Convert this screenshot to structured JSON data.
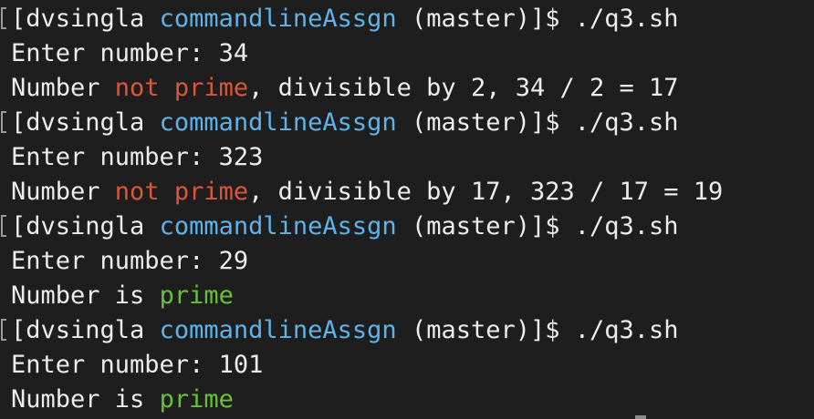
{
  "terminal": {
    "lines": [
      {
        "kind": "prompt",
        "open": "[",
        "user": "dvsingla",
        "dir": "commandlineAssgn",
        "branch": "(master)]$",
        "command": "./q3.sh"
      },
      {
        "kind": "output",
        "text": "Enter number: 34"
      },
      {
        "kind": "result",
        "prefix": "Number ",
        "status": "not prime",
        "suffix": ", divisible by 2, 34 / 2 = 17"
      },
      {
        "kind": "prompt",
        "open": "[",
        "user": "dvsingla",
        "dir": "commandlineAssgn",
        "branch": "(master)]$",
        "command": "./q3.sh"
      },
      {
        "kind": "output",
        "text": "Enter number: 323"
      },
      {
        "kind": "result",
        "prefix": "Number ",
        "status": "not prime",
        "suffix": ", divisible by 17, 323 / 17 = 19"
      },
      {
        "kind": "prompt",
        "open": "[",
        "user": "dvsingla",
        "dir": "commandlineAssgn",
        "branch": "(master)]$",
        "command": "./q3.sh"
      },
      {
        "kind": "output",
        "text": "Enter number: 29"
      },
      {
        "kind": "result",
        "prefix": "Number is ",
        "status": "prime",
        "suffix": ""
      },
      {
        "kind": "prompt",
        "open": "[",
        "user": "dvsingla",
        "dir": "commandlineAssgn",
        "branch": "(master)]$",
        "command": "./q3.sh"
      },
      {
        "kind": "output",
        "text": "Enter number: 101"
      },
      {
        "kind": "result",
        "prefix": "Number is ",
        "status": "prime",
        "suffix": ""
      }
    ]
  },
  "colors": {
    "background": "#1e1e1e",
    "text": "#ececec",
    "directory": "#5fb3e8",
    "not_prime": "#d9583b",
    "prime": "#67c23a"
  }
}
